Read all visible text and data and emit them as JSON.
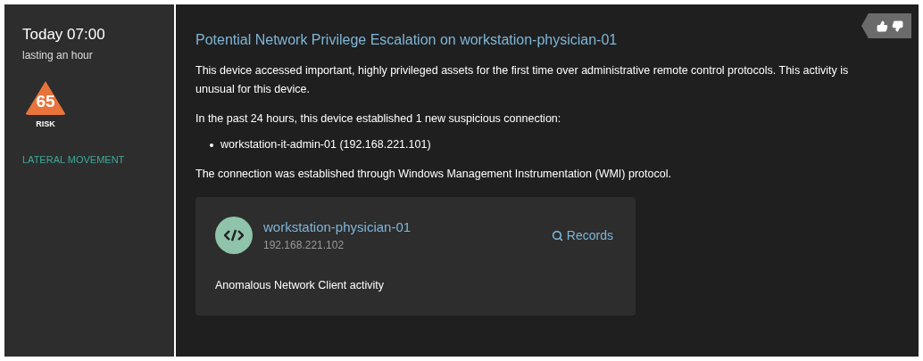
{
  "sidebar": {
    "time": "Today 07:00",
    "duration": "lasting an hour",
    "risk": {
      "score": "65",
      "label": "RISK",
      "color": "#e8743b"
    },
    "category": "LATERAL MOVEMENT"
  },
  "alert": {
    "title": "Potential Network Privilege Escalation on workstation-physician-01",
    "paragraphs": [
      "This device accessed important, highly privileged assets for the first time over administrative remote control protocols. This activity is unusual for this device.",
      "In the past 24 hours, this device established 1 new suspicious connection:"
    ],
    "connections": [
      "workstation-it-admin-01 (192.168.221.101)"
    ],
    "footer": "The connection was established through Windows Management Instrumentation (WMI) protocol.",
    "device": {
      "name": "workstation-physician-01",
      "ip": "192.168.221.102",
      "action": "Records",
      "activity": "Anomalous Network Client activity"
    }
  }
}
